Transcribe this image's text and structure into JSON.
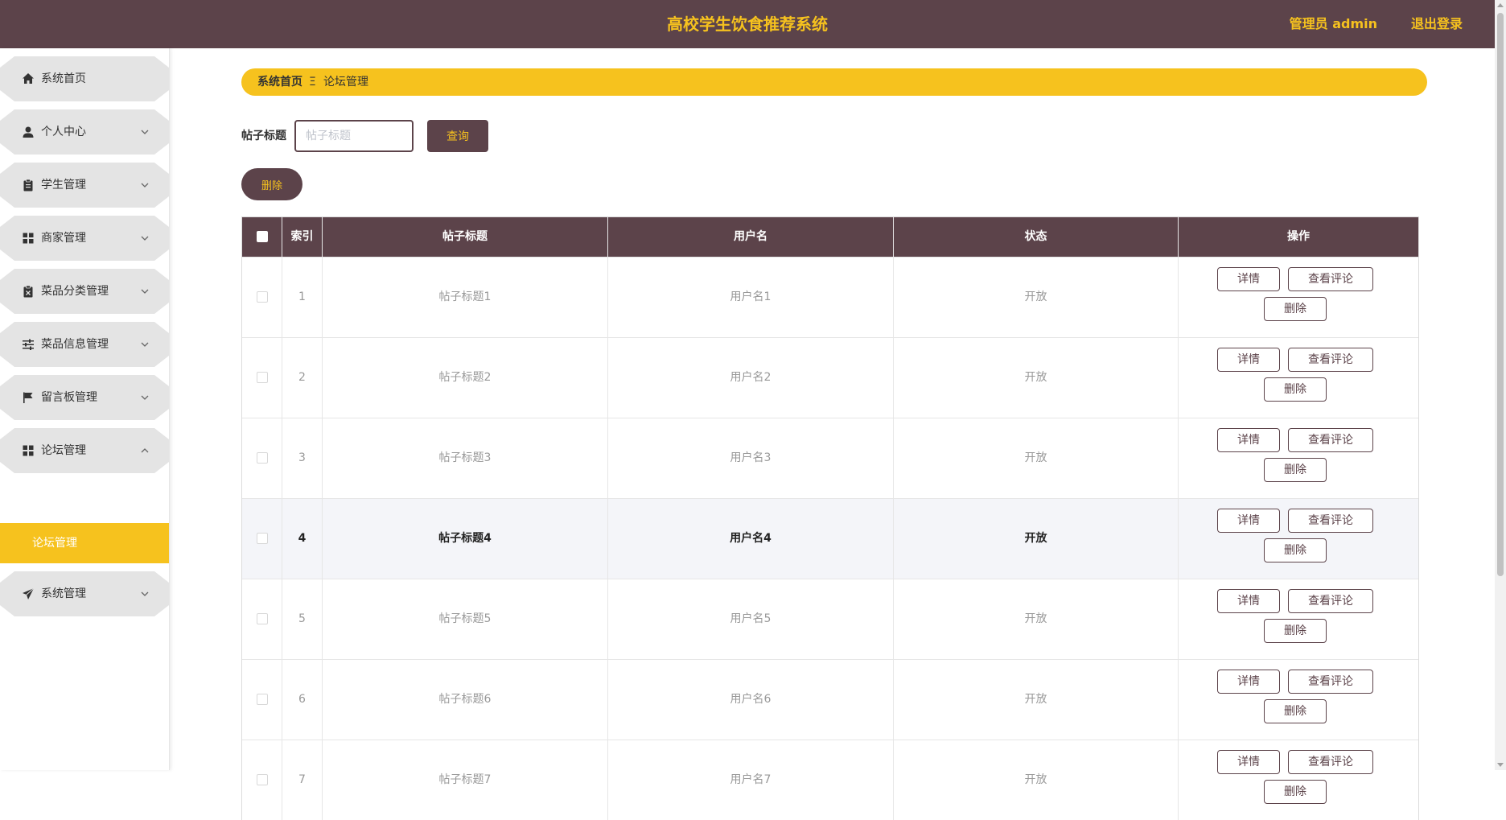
{
  "header": {
    "title": "高校学生饮食推荐系统",
    "user": "管理员 admin",
    "logout": "退出登录"
  },
  "sidebar": {
    "items": [
      {
        "label": "系统首页",
        "icon": "home-icon"
      },
      {
        "label": "个人中心",
        "icon": "person-icon"
      },
      {
        "label": "学生管理",
        "icon": "clipboard-icon"
      },
      {
        "label": "商家管理",
        "icon": "grid-icon"
      },
      {
        "label": "菜品分类管理",
        "icon": "clipboard-x-icon"
      },
      {
        "label": "菜品信息管理",
        "icon": "sliders-icon"
      },
      {
        "label": "留言板管理",
        "icon": "flag-icon"
      },
      {
        "label": "论坛管理",
        "icon": "grid-icon"
      },
      {
        "label": "系统管理",
        "icon": "send-icon"
      }
    ],
    "active_sub": "论坛管理"
  },
  "breadcrumb": {
    "home": "系统首页",
    "separator": "Ξ",
    "current": "论坛管理"
  },
  "search": {
    "label": "帖子标题",
    "placeholder": "帖子标题",
    "button": "查询"
  },
  "actions": {
    "delete": "删除"
  },
  "table": {
    "columns": [
      "索引",
      "帖子标题",
      "用户名",
      "状态",
      "操作"
    ],
    "rows": [
      {
        "index": "1",
        "title": "帖子标题1",
        "user": "用户名1",
        "status": "开放"
      },
      {
        "index": "2",
        "title": "帖子标题2",
        "user": "用户名2",
        "status": "开放"
      },
      {
        "index": "3",
        "title": "帖子标题3",
        "user": "用户名3",
        "status": "开放"
      },
      {
        "index": "4",
        "title": "帖子标题4",
        "user": "用户名4",
        "status": "开放"
      },
      {
        "index": "5",
        "title": "帖子标题5",
        "user": "用户名5",
        "status": "开放"
      },
      {
        "index": "6",
        "title": "帖子标题6",
        "user": "用户名6",
        "status": "开放"
      },
      {
        "index": "7",
        "title": "帖子标题7",
        "user": "用户名7",
        "status": "开放"
      }
    ],
    "row_buttons": {
      "detail": "详情",
      "comments": "查看评论",
      "delete": "删除"
    }
  },
  "colors": {
    "primary": "#5c434a",
    "accent": "#f6c21e"
  }
}
